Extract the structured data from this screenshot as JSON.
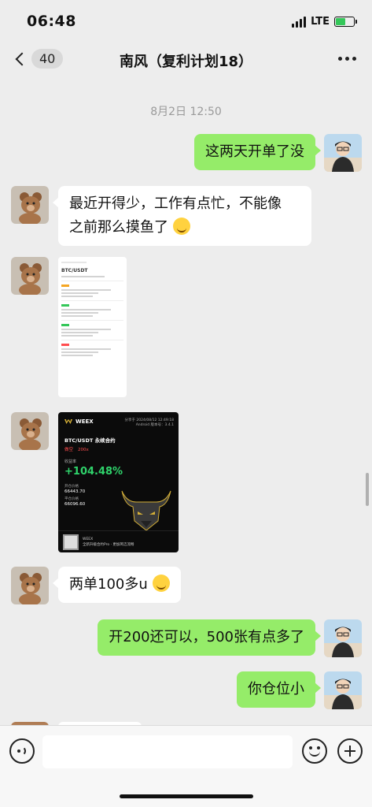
{
  "status_bar": {
    "time": "06:48",
    "network": "LTE"
  },
  "nav": {
    "unread_count": "40",
    "title": "南风（复利计划18）"
  },
  "timestamp": "8月2日 12:50",
  "messages": [
    {
      "side": "out",
      "type": "text",
      "text": "这两天开单了没"
    },
    {
      "side": "in",
      "type": "text",
      "line1": "最近开得少，工作有点忙，不能像",
      "line2": "之前那么摸鱼了"
    },
    {
      "side": "in",
      "type": "image",
      "title": "BTC/USDT"
    },
    {
      "side": "in",
      "type": "image",
      "brand": "WEEX",
      "share_time": "分享于 2024/08/12 12:49:18",
      "app_version": "Android 版本号：3.4.1",
      "pair": "BTC/USDT 永续合约",
      "direction": "做空",
      "leverage": "200x",
      "yield_label": "收益率",
      "yield": "+104.48%",
      "open_label": "开仓价格",
      "open_price": "66443.70",
      "close_label": "平仓价格",
      "close_price": "66096.60",
      "footer_brand": "WEEX",
      "footer_text": "全新升级合约Pro · 更加简洁流畅"
    },
    {
      "side": "in",
      "type": "text",
      "text": "两单100多u"
    },
    {
      "side": "out",
      "type": "text",
      "text": "开200还可以，500张有点多了"
    },
    {
      "side": "out",
      "type": "text",
      "text": "你仓位小"
    }
  ],
  "colors": {
    "out_bubble": "#95ec69",
    "in_bubble": "#ffffff",
    "background": "#ededed",
    "yield_green": "#2fd36b",
    "short_red": "#ff4d4f"
  },
  "icons": [
    "back-chevron-icon",
    "more-icon",
    "voice-icon",
    "emoji-icon",
    "plus-icon"
  ]
}
